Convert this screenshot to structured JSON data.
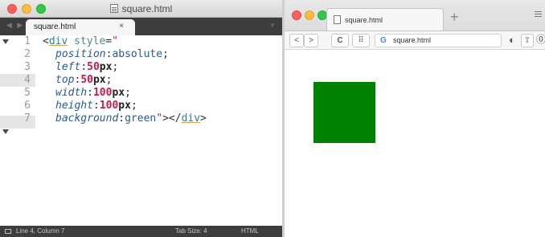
{
  "editor": {
    "window_title": "square.html",
    "tab": {
      "label": "square.html",
      "close": "×"
    },
    "line_numbers": [
      "1",
      "2",
      "3",
      "4",
      "5",
      "6",
      "7"
    ],
    "code": {
      "l1": {
        "open": "<",
        "tag": "div",
        "space": " ",
        "attr": "style",
        "eq": "=",
        "quote": "\""
      },
      "l2": {
        "prop": "position",
        "colon": ":",
        "value": "absolute",
        "semi": ";"
      },
      "l3": {
        "prop": "left",
        "colon": ":",
        "num": "50",
        "unit": "px",
        "semi": ";"
      },
      "l4": {
        "prop": "top",
        "colon": ":",
        "num": "50",
        "unit": "px",
        "semi": ";"
      },
      "l5": {
        "prop": "width",
        "colon": ":",
        "num": "100",
        "unit": "px",
        "semi": ";"
      },
      "l6": {
        "prop": "height",
        "colon": ":",
        "num": "100",
        "unit": "px",
        "semi": ";"
      },
      "l7": {
        "prop": "background",
        "colon": ":",
        "value": "green",
        "quote": "\"",
        "gt": ">",
        "close_open": "</",
        "tag": "div",
        "close_end": ">"
      }
    },
    "status": {
      "position": "Line 4, Column 7",
      "tab_size": "Tab Size: 4",
      "syntax": "HTML"
    }
  },
  "browser": {
    "tab": {
      "title": "square.html"
    },
    "toolbar": {
      "back": "<",
      "forward": ">",
      "reload": "C",
      "grid": "⠿",
      "search_engine": "G",
      "url": "square.html",
      "reader": "◐",
      "share": "⇧",
      "extension": "⓪"
    },
    "new_tab": "+"
  },
  "colors": {
    "square": "#008000",
    "tag": "#2d7ea3",
    "string": "#d0154a",
    "property": "#2d5a8c"
  },
  "icons": {
    "editor_title": "file-icon",
    "browser_tab": "page-icon",
    "search_engine": "google-icon",
    "status": "panel-toggle-icon"
  }
}
